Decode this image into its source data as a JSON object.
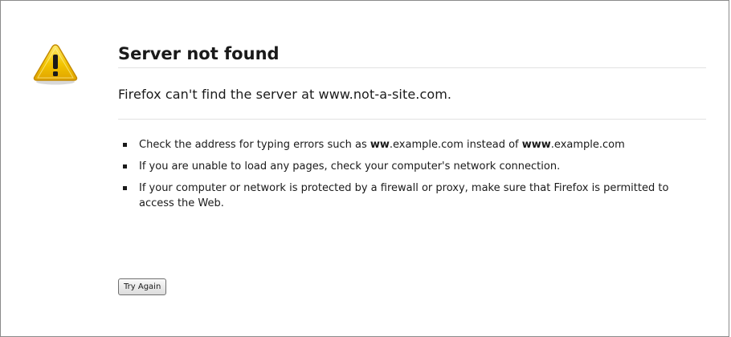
{
  "error_page": {
    "icon": "warning-triangle-icon",
    "title": "Server not found",
    "short_desc": "Firefox can't find the server at www.not-a-site.com.",
    "suggestions": [
      {
        "parts": [
          {
            "text": "Check the address for typing errors such as ",
            "bold": false
          },
          {
            "text": "ww",
            "bold": true
          },
          {
            "text": ".example.com instead of ",
            "bold": false
          },
          {
            "text": "www",
            "bold": true
          },
          {
            "text": ".example.com",
            "bold": false
          }
        ]
      },
      {
        "parts": [
          {
            "text": "If you are unable to load any pages, check your computer's network connection.",
            "bold": false
          }
        ]
      },
      {
        "parts": [
          {
            "text": "If your computer or network is protected by a firewall or proxy, make sure that Firefox is permitted to access the Web.",
            "bold": false
          }
        ]
      }
    ],
    "try_again_label": "Try Again"
  },
  "colors": {
    "icon_yellow": "#f2c400",
    "icon_orange": "#d89a00",
    "divider": "#e2e2e2",
    "border": "#8a8a8a"
  }
}
